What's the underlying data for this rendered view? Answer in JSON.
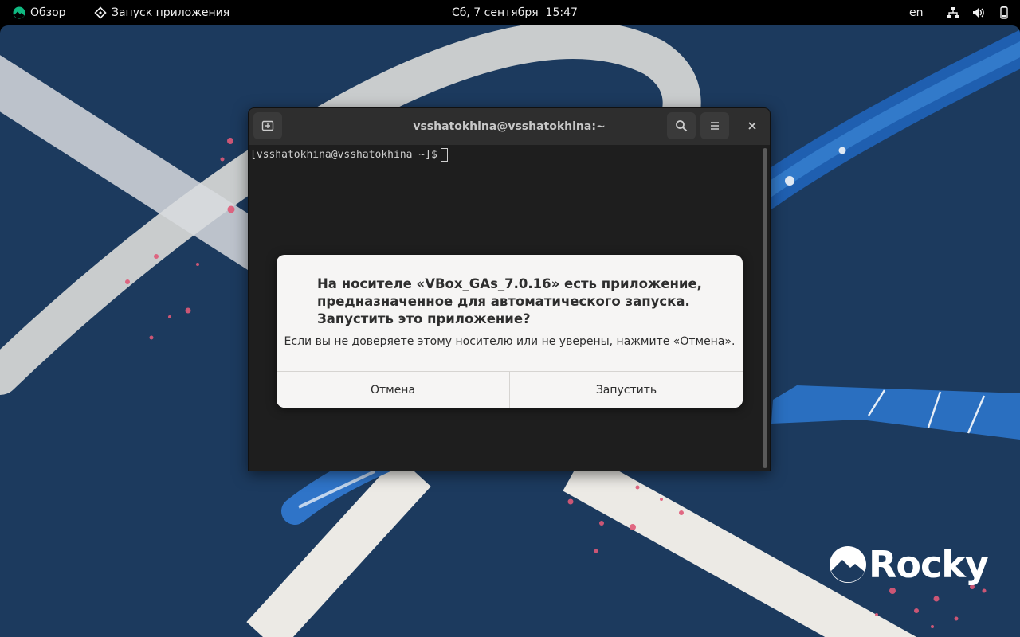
{
  "topbar": {
    "overview_label": "Обзор",
    "launcher_label": "Запуск приложения",
    "clock": "Сб, 7 сентября  15:47",
    "language": "en",
    "status_icons": [
      "network-icon",
      "volume-icon",
      "battery-icon"
    ]
  },
  "terminal": {
    "title": "vsshatokhina@vsshatokhina:~",
    "prompt": "[vsshatokhina@vsshatokhina ~]$"
  },
  "dialog": {
    "heading": "На носителе «VBox_GAs_7.0.16» есть приложение, предназначенное для автоматического запуска. Запустить это приложение?",
    "body": "Если вы не доверяете этому носителю или не уверены, нажмите «Отмена».",
    "cancel_label": "Отмена",
    "run_label": "Запустить"
  },
  "desktop": {
    "logo_text": "Rocky",
    "background_color": "#1c3a5e"
  }
}
